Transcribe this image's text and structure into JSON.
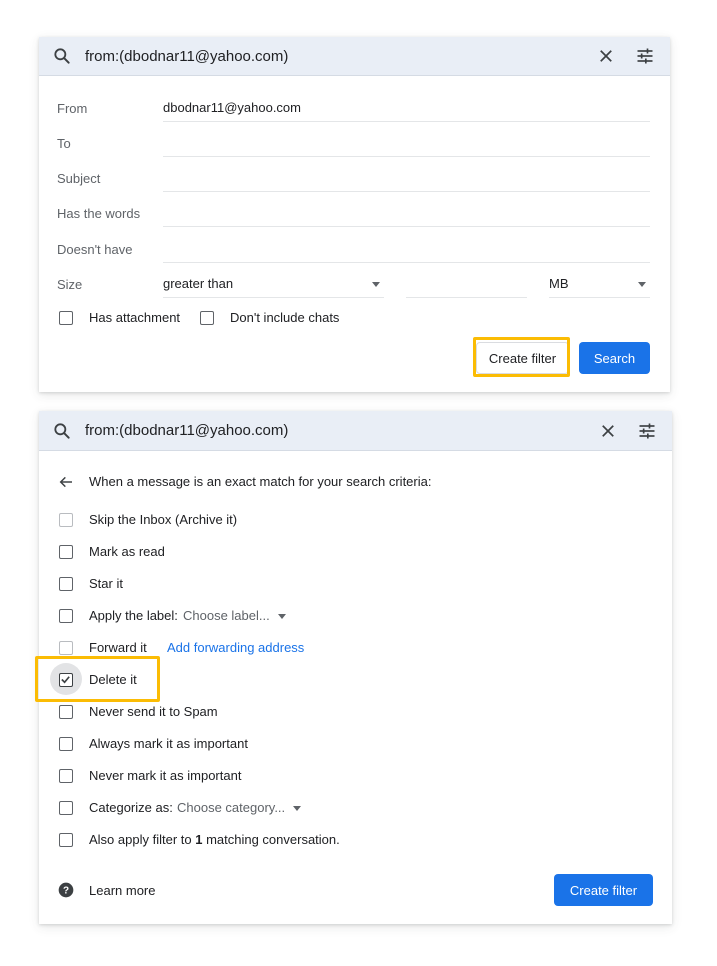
{
  "search": {
    "query": "from:(dbodnar11@yahoo.com)"
  },
  "criteria_form": {
    "from_label": "From",
    "from_value": "dbodnar11@yahoo.com",
    "to_label": "To",
    "subject_label": "Subject",
    "has_words_label": "Has the words",
    "doesnt_have_label": "Doesn't have",
    "size_label": "Size",
    "size_comparator": "greater than",
    "size_unit": "MB",
    "has_attachment_label": "Has attachment",
    "dont_include_chats_label": "Don't include chats",
    "create_filter_label": "Create filter",
    "search_label": "Search"
  },
  "actions_form": {
    "header": "When a message is an exact match for your search criteria:",
    "skip_inbox": "Skip the Inbox (Archive it)",
    "mark_read": "Mark as read",
    "star": "Star it",
    "apply_label": "Apply the label:",
    "choose_label": "Choose label...",
    "forward": "Forward it",
    "add_forwarding": "Add forwarding address",
    "delete": "Delete it",
    "never_spam": "Never send it to Spam",
    "always_important": "Always mark it as important",
    "never_important": "Never mark it as important",
    "categorize": "Categorize as:",
    "choose_category": "Choose category...",
    "also_apply_prefix": "Also apply filter to ",
    "also_apply_count": "1",
    "also_apply_suffix": " matching conversation.",
    "learn_more": "Learn more",
    "create_filter_label": "Create filter"
  },
  "colors": {
    "accent": "#1a73e8",
    "highlight": "#fbbc04",
    "search_bar_bg": "#e9eef6"
  },
  "icons": [
    "search-icon",
    "close-icon",
    "tune-icon",
    "back-arrow-icon",
    "help-icon",
    "checkmark-icon"
  ]
}
